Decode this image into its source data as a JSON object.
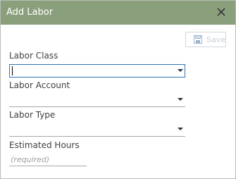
{
  "dialog": {
    "title": "Add Labor",
    "close_icon": "close-icon"
  },
  "toolbar": {
    "save_label": "Save",
    "save_icon": "floppy-disk-icon"
  },
  "form": {
    "labor_class": {
      "label": "Labor Class",
      "value": ""
    },
    "labor_account": {
      "label": "Labor Account",
      "value": ""
    },
    "labor_type": {
      "label": "Labor Type",
      "value": ""
    },
    "estimated_hours": {
      "label": "Estimated Hours",
      "placeholder": "(required)",
      "value": ""
    }
  },
  "colors": {
    "titlebar": "#8a9f7b",
    "focus_border": "#2b77b8",
    "disabled_text": "#c7ced6"
  }
}
